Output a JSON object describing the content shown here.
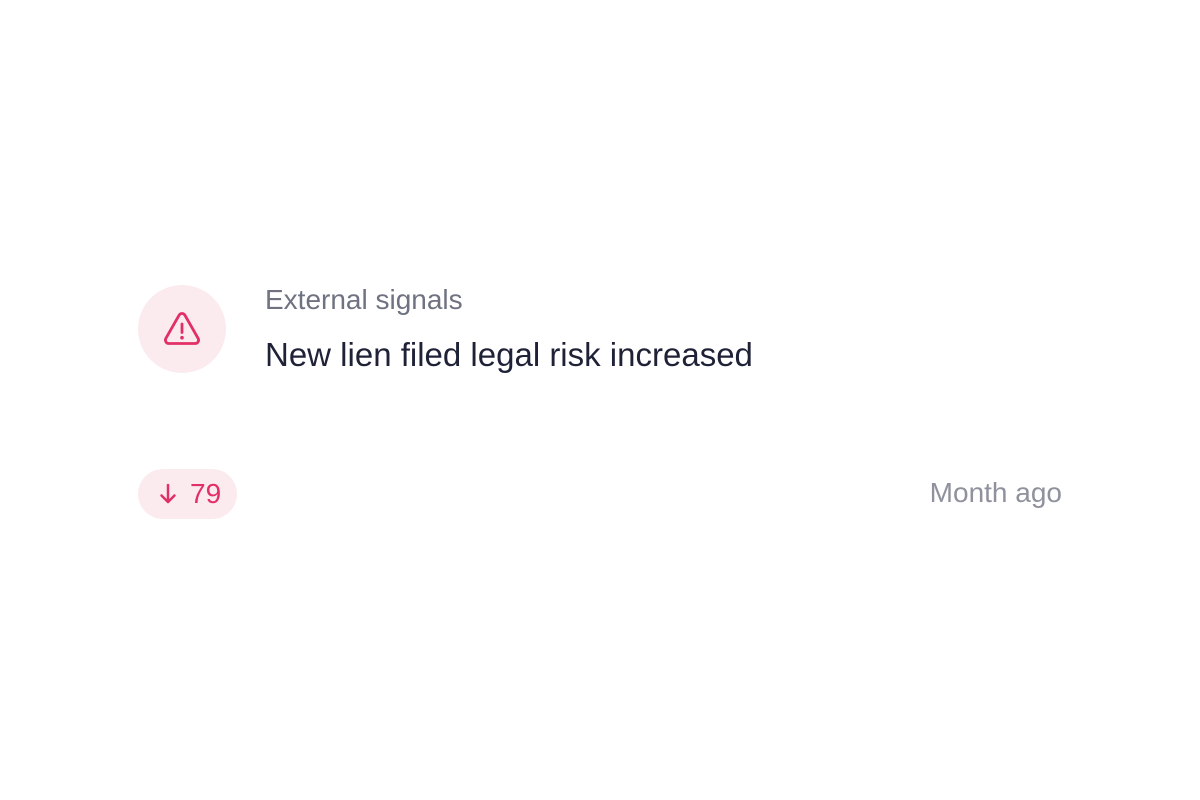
{
  "signal": {
    "category": "External signals",
    "title": "New lien filed legal risk increased",
    "score": {
      "value": "79",
      "direction": "down",
      "icon": "arrow-down-icon",
      "color": "#e22f66"
    },
    "timestamp": "Month ago",
    "icon": "warning-triangle-icon",
    "icon_color": "#e22f66"
  }
}
